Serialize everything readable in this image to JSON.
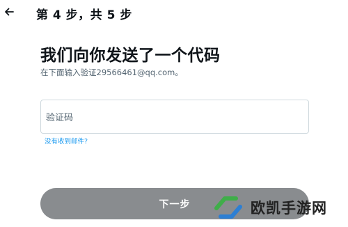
{
  "header": {
    "step_text": "第 4 步，共 5 步"
  },
  "main": {
    "headline": "我们向你发送了一个代码",
    "subtext": "在下面输入验证29566461@qq.com。",
    "code_field_label": "验证码",
    "resend_link": "没有收到邮件?",
    "next_button_label": "下一步"
  },
  "watermark": {
    "text": "欧凯手游网"
  },
  "colors": {
    "accent": "#1d9bf0",
    "button": "#898c8f",
    "watermark_green": "#3fae49",
    "watermark_blue": "#2d7fd3"
  },
  "icons": {
    "back": "back-arrow-icon",
    "watermark_logo": "watermark-logo-icon"
  }
}
